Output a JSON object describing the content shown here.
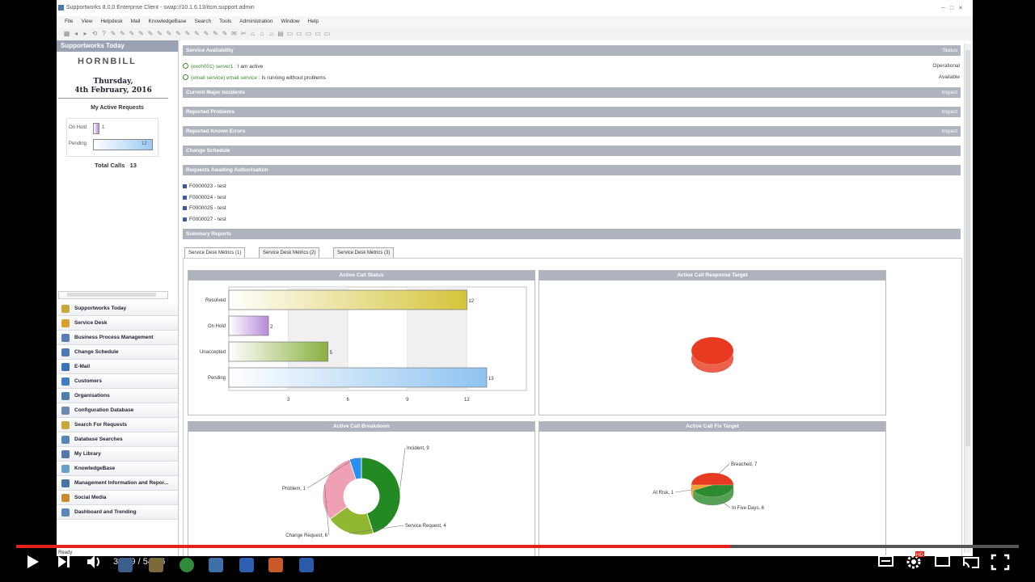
{
  "window": {
    "title": "Supportworks 8.0.0 Enterprise Client - swap://10.1.6.13/itsm.support.admin",
    "menu": [
      "File",
      "View",
      "Helpdesk",
      "Mail",
      "KnowledgeBase",
      "Search",
      "Tools",
      "Administration",
      "Window",
      "Help"
    ]
  },
  "left_panel": {
    "header": "Supportworks Today",
    "logo": "HORNBILL",
    "date_line1": "Thursday,",
    "date_line2": "4th February, 2016",
    "my_active_title": "My Active Requests",
    "bars": [
      {
        "label": "On Hold",
        "value": 1
      },
      {
        "label": "Pending",
        "value": 12
      }
    ],
    "total_calls_label": "Total Calls",
    "total_calls_value": "13",
    "nav": [
      {
        "label": "Supportworks Today",
        "icon": "supportworks-icon",
        "color": "#c9a93a"
      },
      {
        "label": "Service Desk",
        "icon": "service-desk-icon",
        "color": "#d9a030"
      },
      {
        "label": "Business Process Management",
        "icon": "bpm-icon",
        "color": "#5a7fb5"
      },
      {
        "label": "Change Schedule",
        "icon": "calendar-icon",
        "color": "#4a78b4"
      },
      {
        "label": "E-Mail",
        "icon": "email-icon",
        "color": "#3b73b9"
      },
      {
        "label": "Customers",
        "icon": "customers-icon",
        "color": "#3f7fbf"
      },
      {
        "label": "Organisations",
        "icon": "organisations-icon",
        "color": "#4f7fa8"
      },
      {
        "label": "Configuration Database",
        "icon": "database-icon",
        "color": "#6a8ab0"
      },
      {
        "label": "Search For Requests",
        "icon": "search-icon",
        "color": "#c9a93a"
      },
      {
        "label": "Database Searches",
        "icon": "db-search-icon",
        "color": "#5c84b8"
      },
      {
        "label": "My Library",
        "icon": "library-icon",
        "color": "#5578a8"
      },
      {
        "label": "KnowledgeBase",
        "icon": "knowledgebase-icon",
        "color": "#6aa0c8"
      },
      {
        "label": "Management Information and Repor...",
        "icon": "reports-icon",
        "color": "#4a74a8"
      },
      {
        "label": "Social Media",
        "icon": "social-icon",
        "color": "#c98a30"
      },
      {
        "label": "Dashboard and Trending",
        "icon": "dashboard-icon",
        "color": "#5a86b8"
      }
    ]
  },
  "main": {
    "service_availability": {
      "title": "Service Availability",
      "right": "Status",
      "items": [
        {
          "prefix": "(exch001) server1",
          "text": " : I am active",
          "status": "Operational"
        },
        {
          "prefix": "(email service) email service",
          "text": " : Is running without problems",
          "status": "Available"
        }
      ]
    },
    "major_incidents": {
      "title": "Current Major Incidents",
      "right": "Impact"
    },
    "reported_problems": {
      "title": "Reported Problems",
      "right": "Impact"
    },
    "known_errors": {
      "title": "Reported Known Errors",
      "right": "Impact"
    },
    "change_schedule": {
      "title": "Change Schedule"
    },
    "awaiting_auth": {
      "title": "Requests Awaiting Authorisation",
      "items": [
        "F0000023 - test",
        "F0000024 - test",
        "F0000025 - test",
        "F0000027 - test"
      ]
    },
    "summary_reports": {
      "title": "Summary Reports"
    },
    "tabs": [
      "Service Desk Metrics (1)",
      "Service Desk Metrics (2)",
      "Service Desk Metrics (3)"
    ],
    "panels": {
      "p1": "Active Call Status",
      "p2": "Active Call Response Target",
      "p3": "Active Call Breakdown",
      "p4": "Active Call Fix Target"
    }
  },
  "chart_data": [
    {
      "type": "bar",
      "title": "Active Call Status",
      "categories": [
        "Resolved",
        "On Hold",
        "Unaccepted",
        "Pending"
      ],
      "values": [
        12,
        2,
        5,
        13
      ],
      "xticks": [
        3,
        6,
        9,
        12
      ],
      "xlim": [
        0,
        15
      ],
      "colors": [
        "#d4c43a",
        "#b58ad8",
        "#8ab040",
        "#8ec3f0"
      ]
    },
    {
      "type": "pie",
      "title": "Active Call Response Target",
      "labels": [],
      "values": [
        1
      ],
      "colors": [
        "#e83a20"
      ]
    },
    {
      "type": "pie",
      "title": "Active Call Breakdown",
      "labels": [
        "Incident, 9",
        "Service Request, 4",
        "Change Request, 6",
        "Problem, 1"
      ],
      "values": [
        9,
        4,
        6,
        1
      ],
      "colors": [
        "#238a23",
        "#8fb830",
        "#f0a0b4",
        "#2a8ef0"
      ]
    },
    {
      "type": "pie",
      "title": "Active Call Fix Target",
      "labels": [
        "Breached, 7",
        "In Five Days, 6",
        "At Risk, 1"
      ],
      "values": [
        7,
        6,
        1
      ],
      "colors": [
        "#e83a20",
        "#2e8a2e",
        "#f0a030"
      ]
    }
  ],
  "video": {
    "time": "38:59 / 54:46",
    "played_fraction": 0.712,
    "status_text": "Ready"
  }
}
